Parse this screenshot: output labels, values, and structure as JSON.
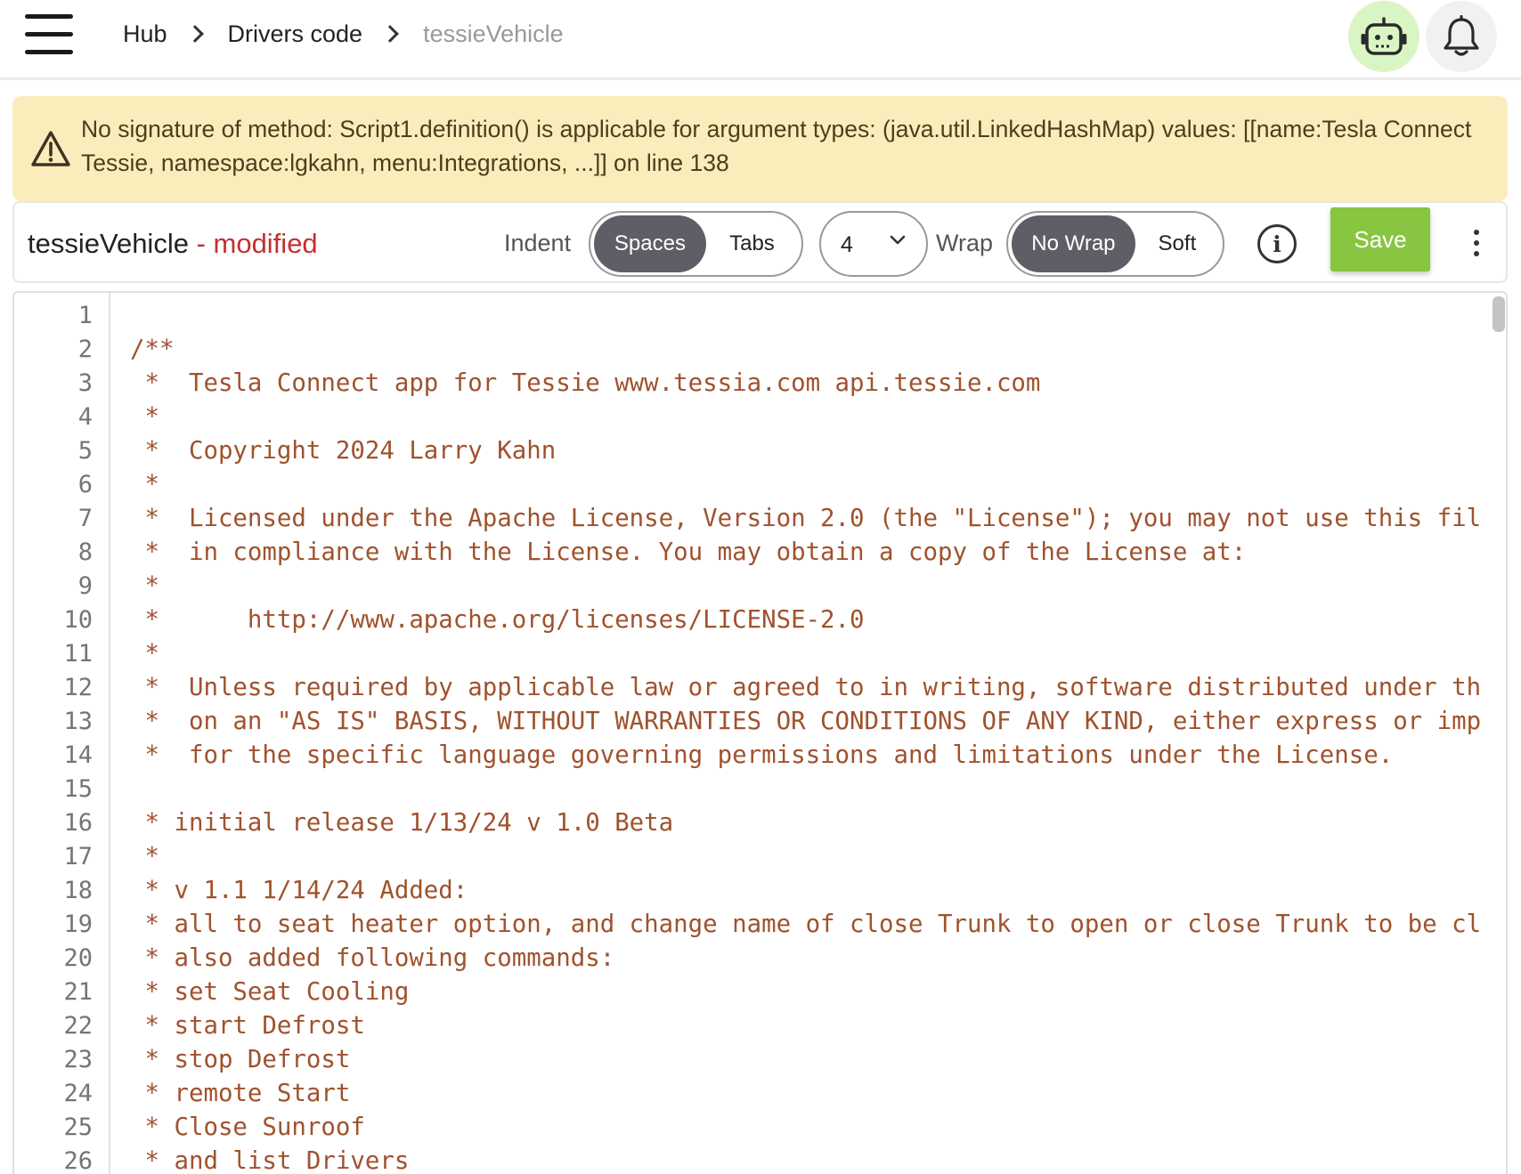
{
  "breadcrumb": {
    "items": [
      "Hub",
      "Drivers code",
      "tessieVehicle"
    ]
  },
  "icons": {
    "menu": "hamburger-menu-icon",
    "robot": "robot-icon",
    "bell": "bell-icon",
    "warning": "warning-triangle-icon",
    "info": "info-icon",
    "more": "more-vertical-icon",
    "chevron": "chevron-down-icon"
  },
  "colors": {
    "banner_bg": "#fbedbb",
    "save_button": "#88c540",
    "modified_text": "#c62f2f",
    "code_comment": "#a0522d",
    "robot_button_bg": "#d9f5c4"
  },
  "error": {
    "message": "No signature of method: Script1.definition() is applicable for argument types: (java.util.LinkedHashMap) values: [[name:Tesla Connect Tessie, namespace:lgkahn, menu:Integrations, ...]] on line 138"
  },
  "toolbar": {
    "file_name": "tessieVehicle",
    "modified_label": " - modified",
    "indent_label": "Indent",
    "indent_options": [
      "Spaces",
      "Tabs"
    ],
    "indent_selected": "Spaces",
    "indent_size": "4",
    "wrap_label": "Wrap",
    "wrap_options": [
      "No Wrap",
      "Soft"
    ],
    "wrap_selected": "No Wrap",
    "save_label": "Save"
  },
  "editor": {
    "line_numbers": [
      "1",
      "2",
      "3",
      "4",
      "5",
      "6",
      "7",
      "8",
      "9",
      "10",
      "11",
      "12",
      "13",
      "14",
      "15",
      "16",
      "17",
      "18",
      "19",
      "20",
      "21",
      "22",
      "23",
      "24",
      "25",
      "26"
    ],
    "lines": [
      "",
      "/**",
      " *  Tesla Connect app for Tessie www.tessia.com api.tessie.com",
      " *",
      " *  Copyright 2024 Larry Kahn",
      " *",
      " *  Licensed under the Apache License, Version 2.0 (the \"License\"); you may not use this fil",
      " *  in compliance with the License. You may obtain a copy of the License at:",
      " *",
      " *      http://www.apache.org/licenses/LICENSE-2.0",
      " *",
      " *  Unless required by applicable law or agreed to in writing, software distributed under th",
      " *  on an \"AS IS\" BASIS, WITHOUT WARRANTIES OR CONDITIONS OF ANY KIND, either express or imp",
      " *  for the specific language governing permissions and limitations under the License.",
      "",
      " * initial release 1/13/24 v 1.0 Beta",
      " *",
      " * v 1.1 1/14/24 Added:",
      " * all to seat heater option, and change name of close Trunk to open or close Trunk to be cl",
      " * also added following commands:",
      " * set Seat Cooling",
      " * start Defrost",
      " * stop Defrost",
      " * remote Start",
      " * Close Sunroof",
      " * and list Drivers"
    ]
  }
}
